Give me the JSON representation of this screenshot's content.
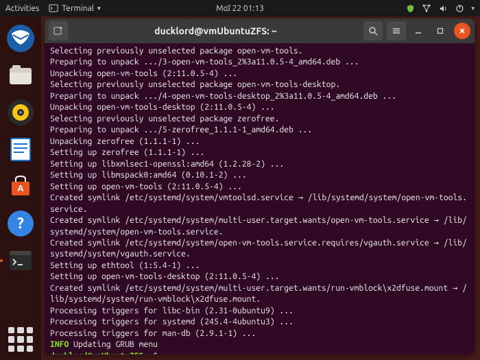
{
  "topbar": {
    "activities": "Activities",
    "app_label": "Terminal",
    "clock": "Μαΐ 22  01:13"
  },
  "window": {
    "title": "ducklord@vmUbuntuZFS: ~"
  },
  "terminal": {
    "lines": [
      "Selecting previously unselected package open-vm-tools.",
      "Preparing to unpack .../3-open-vm-tools_2%3a11.0.5-4_amd64.deb ...",
      "Unpacking open-vm-tools (2:11.0.5-4) ...",
      "Selecting previously unselected package open-vm-tools-desktop.",
      "Preparing to unpack .../4-open-vm-tools-desktop_2%3a11.0.5-4_amd64.deb ...",
      "Unpacking open-vm-tools-desktop (2:11.0.5-4) ...",
      "Selecting previously unselected package zerofree.",
      "Preparing to unpack .../5-zerofree_1.1.1-1_amd64.deb ...",
      "Unpacking zerofree (1.1.1-1) ...",
      "Setting up zerofree (1.1.1-1) ...",
      "Setting up libxmlsec1-openssl:amd64 (1.2.28-2) ...",
      "Setting up libmspack0:amd64 (0.10.1-2) ...",
      "Setting up open-vm-tools (2:11.0.5-4) ...",
      "Created symlink /etc/systemd/system/vmtoolsd.service → /lib/systemd/system/open-vm-tools.service.",
      "Created symlink /etc/systemd/system/multi-user.target.wants/open-vm-tools.service → /lib/systemd/system/open-vm-tools.service.",
      "Created symlink /etc/systemd/system/open-vm-tools.service.requires/vgauth.service → /lib/systemd/system/vgauth.service.",
      "Setting up ethtool (1:5.4-1) ...",
      "Setting up open-vm-tools-desktop (2:11.0.5-4) ...",
      "Created symlink /etc/systemd/system/multi-user.target.wants/run-vmblock\\x2dfuse.mount → /lib/systemd/system/run-vmblock\\x2dfuse.mount.",
      "Processing triggers for libc-bin (2.31-0ubuntu9) ...",
      "Processing triggers for systemd (245.4-4ubuntu3) ...",
      "Processing triggers for man-db (2.9.1-1) ..."
    ],
    "info_tag": "INFO",
    "info_msg": "Updating GRUB menu",
    "prompt_user": "ducklord@vmUbuntuZFS",
    "prompt_path": "~",
    "prompt_symbol": "$"
  },
  "dock": {
    "items": [
      {
        "name": "thunderbird"
      },
      {
        "name": "files"
      },
      {
        "name": "rhythmbox"
      },
      {
        "name": "libreoffice-writer"
      },
      {
        "name": "software-center"
      },
      {
        "name": "help"
      },
      {
        "name": "terminal"
      }
    ]
  }
}
